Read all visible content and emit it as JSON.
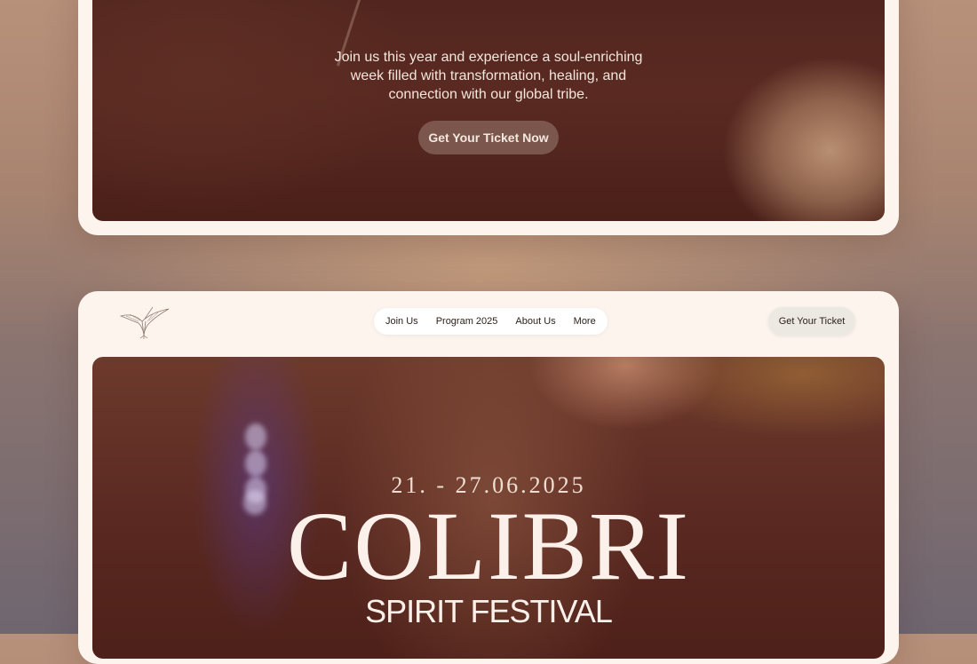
{
  "top_section": {
    "tagline": "Join us this year and experience a soul-enriching week filled with transformation, healing, and connection with our global tribe.",
    "cta_label": "Get Your Ticket Now"
  },
  "header": {
    "logo_icon": "hummingbird-logo-icon",
    "nav": [
      {
        "label": "Join Us"
      },
      {
        "label": "Program 2025"
      },
      {
        "label": "About Us"
      },
      {
        "label": "More"
      }
    ],
    "ticket_label": "Get Your Ticket"
  },
  "hero": {
    "dates": "21. - 27.06.2025",
    "title": "COLIBRI",
    "subtitle": "SPIRIT FESTIVAL"
  }
}
